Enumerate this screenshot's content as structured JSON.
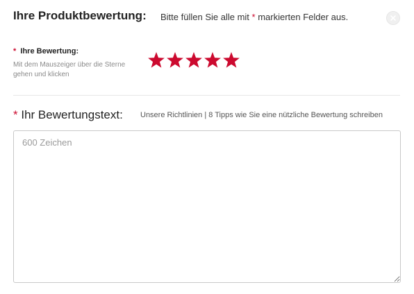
{
  "header": {
    "title": "Ihre Produktbewertung:",
    "hint_prefix": "Bitte füllen Sie alle mit ",
    "hint_star": "*",
    "hint_suffix": " markierten Felder aus.",
    "close_icon": "close-icon"
  },
  "rating": {
    "required_marker": "*",
    "label": "Ihre Bewertung:",
    "help": "Mit dem Mauszeiger über die Sterne gehen und klicken",
    "stars_filled": 5,
    "stars_total": 5,
    "star_color": "#cc0a2f",
    "star_icon": "star-icon"
  },
  "review_text": {
    "required_marker": "*",
    "label": "Ihr Bewertungstext:",
    "guidelines_link": "Unsere Richtlinien",
    "separator": " | ",
    "tips_link": "8 Tipps wie Sie eine nützliche Bewertung schreiben",
    "placeholder": "600 Zeichen",
    "value": ""
  },
  "colors": {
    "required": "#cc0a2f",
    "border": "#c8c8c8",
    "divider": "#e6e6e6"
  }
}
